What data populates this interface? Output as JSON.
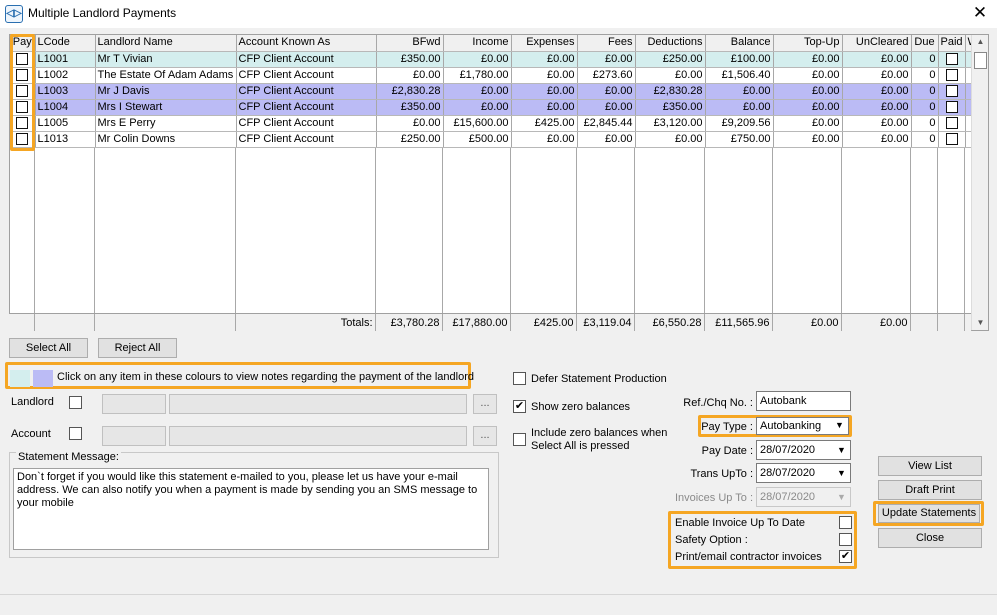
{
  "window": {
    "title": "Multiple Landlord Payments",
    "close": "✕",
    "icon": "◁▷"
  },
  "grid": {
    "headers": [
      "Pay",
      "LCode",
      "Landlord Name",
      "Account Known As",
      "BFwd",
      "Income",
      "Expenses",
      "Fees",
      "Deductions",
      "Balance",
      "Top-Up",
      "UnCleared",
      "Due",
      "Paid",
      "W"
    ],
    "rows": [
      {
        "lcode": "L1001",
        "name": "Mr T Vivian",
        "account": "CFP Client Account",
        "bfwd": "£350.00",
        "income": "£0.00",
        "expenses": "£0.00",
        "fees": "£0.00",
        "deductions": "£250.00",
        "balance": "£100.00",
        "topup": "£0.00",
        "uncleared": "£0.00",
        "due": "0"
      },
      {
        "lcode": "L1002",
        "name": "The Estate Of Adam Adams",
        "account": "CFP Client Account",
        "bfwd": "£0.00",
        "income": "£1,780.00",
        "expenses": "£0.00",
        "fees": "£273.60",
        "deductions": "£0.00",
        "balance": "£1,506.40",
        "topup": "£0.00",
        "uncleared": "£0.00",
        "due": "0"
      },
      {
        "lcode": "L1003",
        "name": "Mr J Davis",
        "account": "CFP Client Account",
        "bfwd": "£2,830.28",
        "income": "£0.00",
        "expenses": "£0.00",
        "fees": "£0.00",
        "deductions": "£2,830.28",
        "balance": "£0.00",
        "topup": "£0.00",
        "uncleared": "£0.00",
        "due": "0"
      },
      {
        "lcode": "L1004",
        "name": "Mrs I Stewart",
        "account": "CFP Client Account",
        "bfwd": "£350.00",
        "income": "£0.00",
        "expenses": "£0.00",
        "fees": "£0.00",
        "deductions": "£350.00",
        "balance": "£0.00",
        "topup": "£0.00",
        "uncleared": "£0.00",
        "due": "0"
      },
      {
        "lcode": "L1005",
        "name": "Mrs E Perry",
        "account": "CFP Client Account",
        "bfwd": "£0.00",
        "income": "£15,600.00",
        "expenses": "£425.00",
        "fees": "£2,845.44",
        "deductions": "£3,120.00",
        "balance": "£9,209.56",
        "topup": "£0.00",
        "uncleared": "£0.00",
        "due": "0"
      },
      {
        "lcode": "L1013",
        "name": "Mr Colin Downs",
        "account": "CFP Client Account",
        "bfwd": "£250.00",
        "income": "£500.00",
        "expenses": "£0.00",
        "fees": "£0.00",
        "deductions": "£0.00",
        "balance": "£750.00",
        "topup": "£0.00",
        "uncleared": "£0.00",
        "due": "0"
      }
    ],
    "totals": {
      "label": "Totals:",
      "bfwd": "£3,780.28",
      "income": "£17,880.00",
      "expenses": "£425.00",
      "fees": "£3,119.04",
      "deductions": "£6,550.28",
      "balance": "£11,565.96",
      "topup": "£0.00",
      "uncleared": "£0.00"
    }
  },
  "buttons": {
    "select_all": "Select All",
    "reject_all": "Reject All",
    "view_list": "View List",
    "draft_print": "Draft Print",
    "update_statements": "Update Statements",
    "close": "Close",
    "ellipsis": "..."
  },
  "legend": {
    "text": "Click on any item in these colours to view notes regarding the payment of the landlord",
    "colors": [
      "#d4eeee",
      "#bbbbf5"
    ]
  },
  "filters": {
    "landlord_label": "Landlord",
    "account_label": "Account"
  },
  "statement": {
    "label": "Statement Message:",
    "text": "Don`t forget if you would like this statement e-mailed to you, please let us have your e-mail address. We can also notify you when a payment is made by sending you an SMS message to your mobile"
  },
  "options": {
    "defer_statement": "Defer Statement Production",
    "show_zero": "Show zero balances",
    "include_zero": "Include zero balances when Select All is pressed",
    "show_zero_checked": "✔"
  },
  "payment": {
    "ref_label": "Ref./Chq No. :",
    "ref_value": "Autobank",
    "pay_type_label": "Pay Type :",
    "pay_type_value": "Autobanking",
    "pay_date_label": "Pay Date :",
    "pay_date_value": "28/07/2020",
    "trans_upto_label": "Trans UpTo :",
    "trans_upto_value": "28/07/2020",
    "invoices_upto_label": "Invoices Up To :",
    "invoices_upto_value": "28/07/2020",
    "dropdown_arrow": "▼"
  },
  "invoice_options": {
    "enable_invoice": "Enable Invoice Up To Date",
    "safety_option": "Safety Option :",
    "print_contractor": "Print/email contractor invoices",
    "print_contractor_checked": "✔"
  },
  "colors": {
    "highlight": "#f5a623",
    "cyan_row": "#d4eeee",
    "lavender_row": "#bbbbf5"
  }
}
